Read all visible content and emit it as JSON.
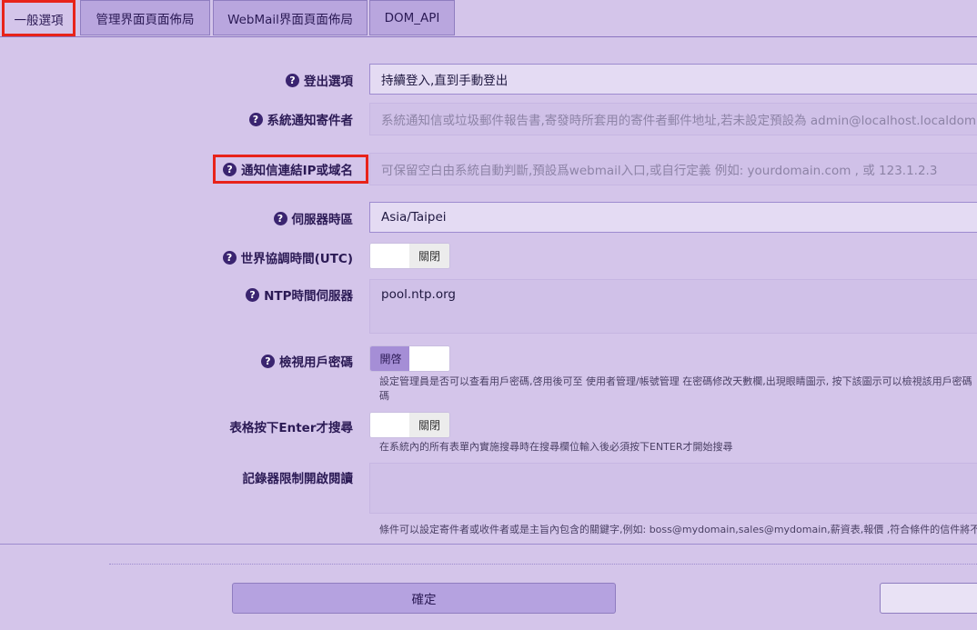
{
  "tabs": [
    {
      "label": "一般選項"
    },
    {
      "label": "管理界面頁面佈局"
    },
    {
      "label": "WebMail界面頁面佈局"
    },
    {
      "label": "DOM_API"
    }
  ],
  "help_icon": "question-circle-icon",
  "settings": {
    "logout": {
      "label": "登出選項",
      "value": "持續登入,直到手動登出"
    },
    "notify_sender": {
      "label": "系統通知寄件者",
      "placeholder": "系統通知信或垃圾郵件報告書,寄發時所套用的寄件者郵件地址,若未設定預設為 admin@localhost.localdom"
    },
    "notify_link": {
      "label": "通知信連結IP或域名",
      "placeholder": "可保留空白由系統自動判斷,預設爲webmail入口,或自行定義 例如: yourdomain.com , 或 123.1.2.3"
    },
    "timezone": {
      "label": "伺服器時區",
      "value": "Asia/Taipei"
    },
    "utc": {
      "label": "世界協調時間(UTC)",
      "state": "關閉"
    },
    "ntp": {
      "label": "NTP時間伺服器",
      "value": "pool.ntp.org"
    },
    "view_password": {
      "label": "檢視用戶密碼",
      "state": "開啓",
      "hint_line1": "設定管理員是否可以查看用戶密碼,啓用後可至 使用者管理/帳號管理 在密碼修改天數欄,出現眼睛圖示, 按下該圖示可以檢視該用戶密碼",
      "hint_line2": "碼"
    },
    "enter_search": {
      "label": "表格按下Enter才搜尋",
      "state": "關閉",
      "hint": "在系統內的所有表單內實施搜尋時在搜尋欄位輸入後必須按下ENTER才開始搜尋"
    },
    "logger_limit": {
      "label": "記錄器限制開啟閱讀",
      "hint": "條件可以設定寄件者或收件者或是主旨內包含的關鍵字,例如: boss@mydomain,sales@mydomain,薪資表,報價 ,符合條件的信件將不允"
    }
  },
  "buttons": {
    "confirm": "確定"
  },
  "colors": {
    "highlight": "#e8231a",
    "accent": "#a58ed6",
    "background": "#d4c5ea"
  }
}
